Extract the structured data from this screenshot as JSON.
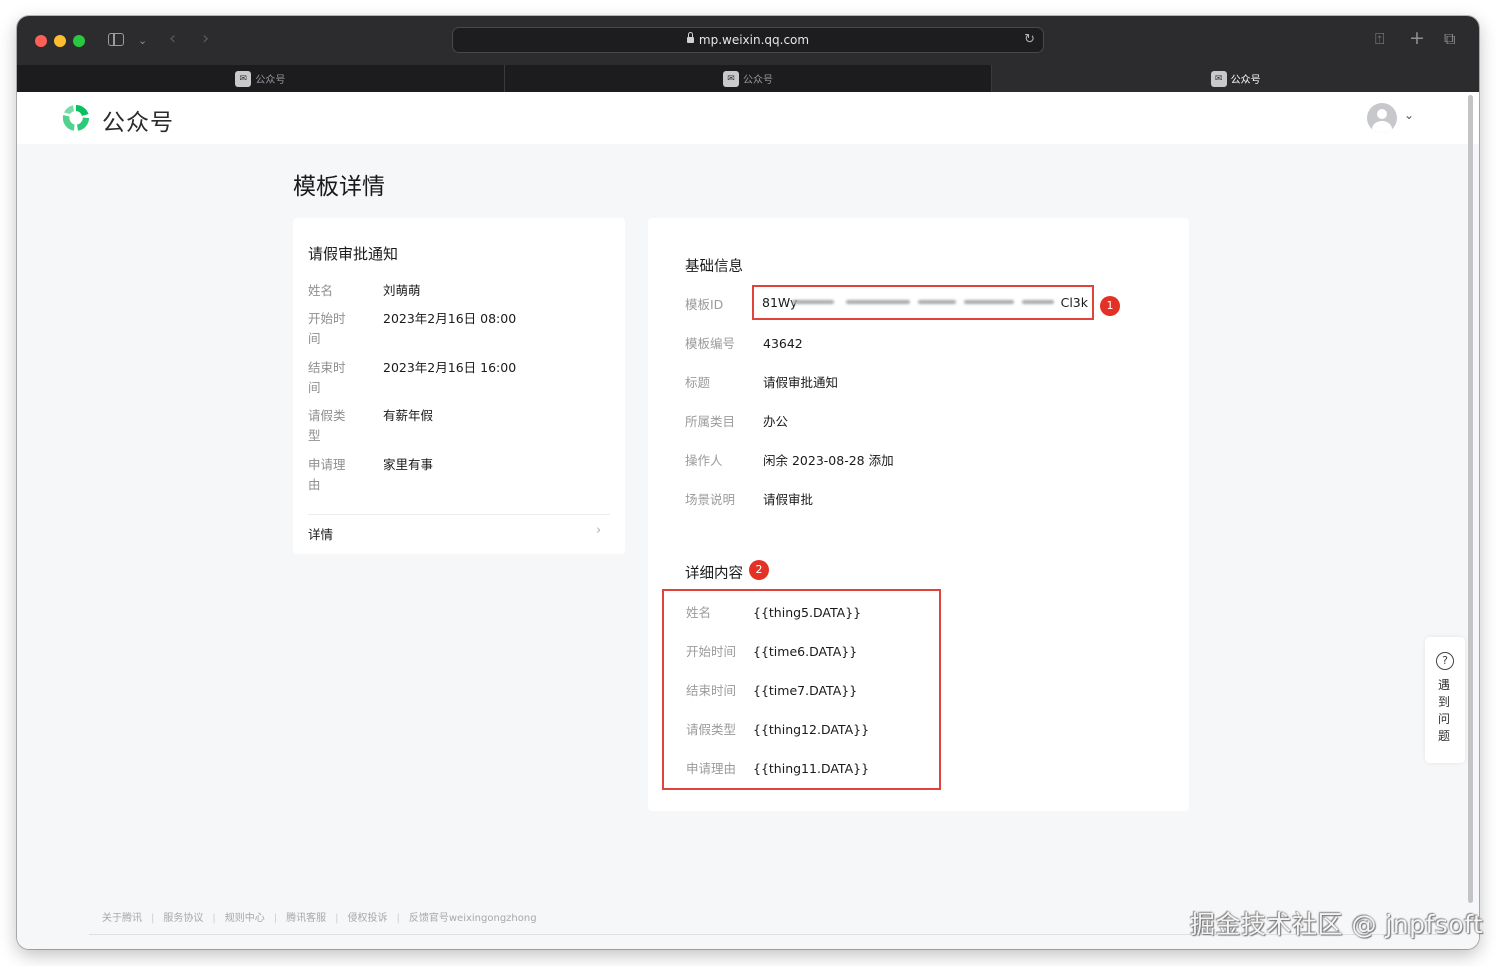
{
  "browser": {
    "url": "mp.weixin.qq.com",
    "tabs": [
      {
        "label": "公众号",
        "active": false
      },
      {
        "label": "公众号",
        "active": false
      },
      {
        "label": "公众号",
        "active": true
      }
    ]
  },
  "header": {
    "logo_text": "公众号"
  },
  "page": {
    "title": "模板详情"
  },
  "preview": {
    "title": "请假审批通知",
    "rows": [
      {
        "label": "姓名",
        "value": "刘萌萌"
      },
      {
        "label": "开始时间",
        "value": "2023年2月16日 08:00"
      },
      {
        "label": "结束时间",
        "value": "2023年2月16日 16:00"
      },
      {
        "label": "请假类型",
        "value": "有薪年假"
      },
      {
        "label": "申请理由",
        "value": "家里有事"
      }
    ],
    "detail_link": "详情"
  },
  "basic_info": {
    "title": "基础信息",
    "template_id_label": "模板ID",
    "template_id_start": "81Wy",
    "template_id_end": "Cl3k",
    "rows": [
      {
        "label": "模板编号",
        "value": "43642"
      },
      {
        "label": "标题",
        "value": "请假审批通知"
      },
      {
        "label": "所属类目",
        "value": "办公"
      },
      {
        "label": "操作人",
        "value": "闲余 2023-08-28 添加"
      },
      {
        "label": "场景说明",
        "value": "请假审批"
      }
    ],
    "badge": "1"
  },
  "detail_content": {
    "title": "详细内容",
    "badge": "2",
    "rows": [
      {
        "label": "姓名",
        "value": "{{thing5.DATA}}"
      },
      {
        "label": "开始时间",
        "value": "{{time6.DATA}}"
      },
      {
        "label": "结束时间",
        "value": "{{time7.DATA}}"
      },
      {
        "label": "请假类型",
        "value": "{{thing12.DATA}}"
      },
      {
        "label": "申请理由",
        "value": "{{thing11.DATA}}"
      }
    ]
  },
  "help": {
    "text": "遇到问题"
  },
  "footer": {
    "links": [
      "关于腾讯",
      "服务协议",
      "规则中心",
      "腾讯客服",
      "侵权投诉",
      "反馈官号weixingongzhong"
    ]
  },
  "watermark": "掘金技术社区 @ jnpfsoft",
  "colors": {
    "annotation_red": "#e0433b",
    "badge_red": "#e33126",
    "logo_green": "#07c160"
  }
}
